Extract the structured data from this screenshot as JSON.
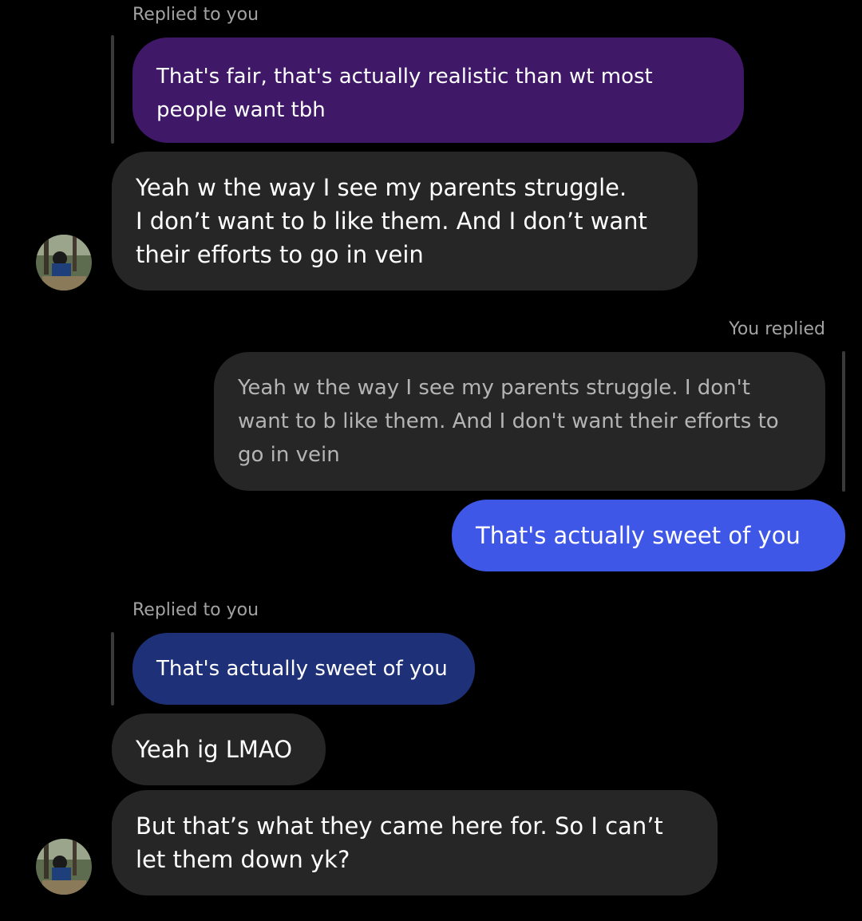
{
  "colors": {
    "background": "#000000",
    "incoming_bubble": "#262626",
    "outgoing_bubble": "#3f57e6",
    "quoted_purple": "#3f1868",
    "quoted_blue": "#1e3178",
    "label_gray": "#a3a3a3"
  },
  "icons": {
    "avatar": "avatar-photo"
  },
  "thread": {
    "reply_label_top": "Replied to you",
    "quoted_top": "That's fair, that's actually realistic than wt most\npeople want tbh",
    "msg1": "Yeah w the way I see my parents struggle.\nI don’t want to b like them. And I don’t want\ntheir efforts to go in vein",
    "you_replied_label": "You replied",
    "quoted_mine": "Yeah w the way I see my parents struggle. I don't\nwant to b like them. And I don't want their efforts to\ngo in vein",
    "sent_msg": "That's actually sweet of you",
    "reply_label_bottom": "Replied to you",
    "quoted_bottom": "That's actually sweet of you",
    "msg2": "Yeah ig LMAO",
    "msg3": "But that’s what they came here for. So I can’t\nlet them down yk?"
  }
}
